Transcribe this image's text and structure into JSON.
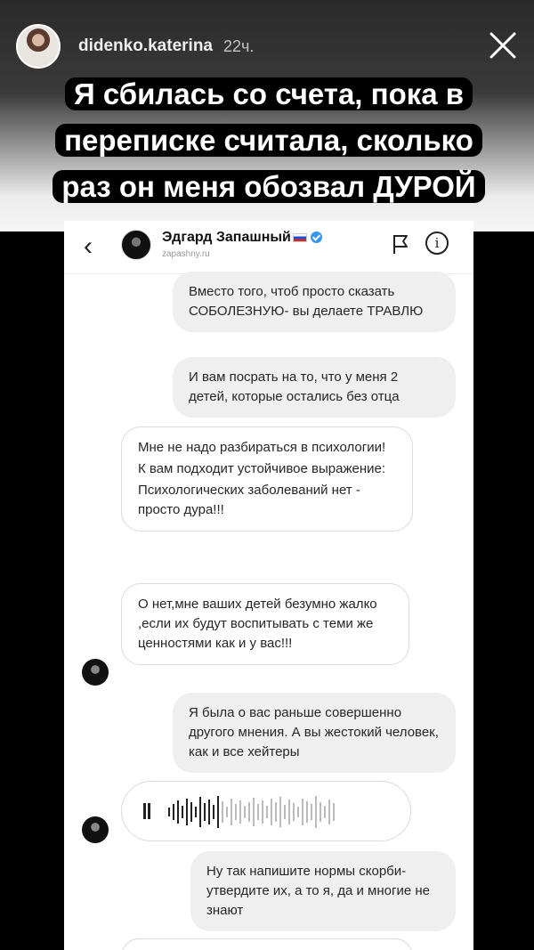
{
  "story": {
    "username": "didenko.katerina",
    "time": "22ч.",
    "headline": "Я сбилась со счета, пока в переписке считала, сколько раз он меня обозвал ДУРОЙ"
  },
  "chat": {
    "contact_name": "Эдгард Запашный",
    "contact_handle": "zapashny.ru",
    "info_glyph": "i",
    "back_glyph": "‹",
    "messages": [
      {
        "side": "out",
        "lines": [
          "Вместо того, чтоб просто сказать СОБОЛЕЗНУЮ- вы делаете ТРАВЛЮ"
        ]
      },
      {
        "side": "out",
        "lines": [
          "И вам посрать на то, что у меня 2 детей, которые остались без отца"
        ]
      },
      {
        "side": "in",
        "lines": [
          "Мне не надо разбираться в психологии!",
          "К вам подходит устойчивое выражение:",
          "Психологических заболеваний нет - просто дура!!!"
        ]
      },
      {
        "side": "in",
        "lines": [
          "О нет,мне ваших детей безумно жалко ,если их будут воспитывать с теми же ценностями как и у вас!!!"
        ]
      },
      {
        "side": "out",
        "lines": [
          "Я была о вас раньше совершенно другого мнения. А вы жестокий человек, как и все хейтеры"
        ]
      },
      {
        "side": "out",
        "lines": [
          "Ну так напишите нормы скорби- утвердите их, а то я, да и многие не знают"
        ]
      }
    ],
    "voice_message": {
      "played_fraction": 0.3
    }
  }
}
